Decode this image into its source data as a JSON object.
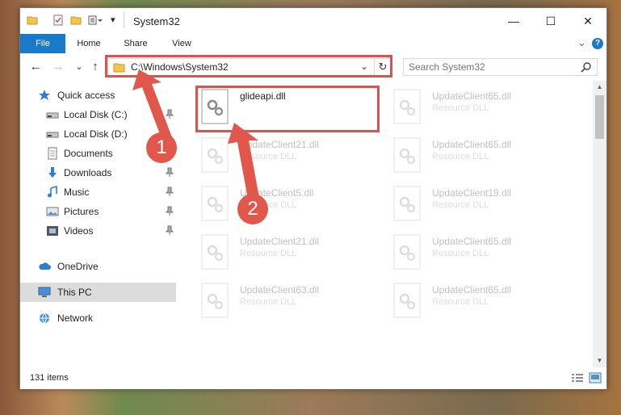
{
  "window": {
    "title": "System32",
    "caption": {
      "minimize": "—",
      "maximize": "☐",
      "close": "✕"
    }
  },
  "ribbon": {
    "tabs": [
      "File",
      "Home",
      "Share",
      "View"
    ],
    "collapse_glyph": "⌄",
    "help_glyph": "?"
  },
  "nav": {
    "back": "←",
    "forward": "→",
    "recent": "⌄",
    "up": "↑",
    "address": "C:\\Windows\\System32",
    "address_dropdown": "⌄",
    "refresh": "↻",
    "search_placeholder": "Search System32"
  },
  "sidebar": {
    "quick_access": "Quick access",
    "items": [
      {
        "label": "Local Disk (C:)",
        "icon": "drive-icon",
        "pinned": true
      },
      {
        "label": "Local Disk (D:)",
        "icon": "drive-icon",
        "pinned": false
      },
      {
        "label": "Documents",
        "icon": "documents-icon",
        "pinned": true
      },
      {
        "label": "Downloads",
        "icon": "downloads-icon",
        "pinned": true
      },
      {
        "label": "Music",
        "icon": "music-icon",
        "pinned": true
      },
      {
        "label": "Pictures",
        "icon": "pictures-icon",
        "pinned": true
      },
      {
        "label": "Videos",
        "icon": "videos-icon",
        "pinned": true
      }
    ],
    "onedrive": "OneDrive",
    "this_pc": "This PC",
    "network": "Network"
  },
  "files": [
    {
      "name": "glideapi.dll",
      "type": ""
    },
    {
      "name": "UpdateClient65.dll",
      "type": "Resource DLL"
    },
    {
      "name": "UpdateClient21.dll",
      "type": "Resource DLL"
    },
    {
      "name": "UpdateClient65.dll",
      "type": "Resource DLL"
    },
    {
      "name": "UpdateClient5.dll",
      "type": "Resource DLL"
    },
    {
      "name": "UpdateClient19.dll",
      "type": "Resource DLL"
    },
    {
      "name": "UpdateClient21.dll",
      "type": "Resource DLL"
    },
    {
      "name": "UpdateClient65.dll",
      "type": "Resource DLL"
    },
    {
      "name": "UpdateClient63.dll",
      "type": "Resource DLL"
    },
    {
      "name": "UpdateClient65.dll",
      "type": "Resource DLL"
    }
  ],
  "status": {
    "item_count": "131 items"
  },
  "annotations": {
    "step1": "1",
    "step2": "2"
  },
  "colors": {
    "accent": "#1979ca",
    "annotation": "#d9534f",
    "folder": "#f3c54a"
  }
}
